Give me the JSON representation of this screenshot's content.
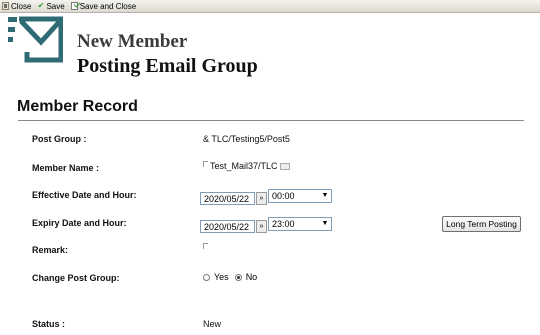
{
  "toolbar": {
    "close_label": "Close",
    "save_label": "Save",
    "save_close_label": "Save and Close"
  },
  "header": {
    "title_line1": "New Member",
    "title_line2": "Posting Email Group"
  },
  "section": {
    "title": "Member Record"
  },
  "form": {
    "post_group_label": "Post Group :",
    "post_group_value": "& TLC/Testing5/Post5",
    "member_name_label": "Member Name :",
    "member_name_value": "Test_Mail37/TLC",
    "effective_label": "Effective Date and Hour:",
    "effective_date": "2020/05/22",
    "effective_hour": "00:00",
    "expiry_label": "Expiry Date and Hour:",
    "expiry_date": "2020/05/22",
    "expiry_hour": "23:00",
    "long_term_button": "Long Term Posting",
    "remark_label": "Remark:",
    "remark_value": "",
    "change_group_label": "Change Post Group:",
    "option_yes": "Yes",
    "option_no": "No",
    "selected_option": "No",
    "status_label": "Status :",
    "status_value": "New"
  },
  "colors": {
    "logo_teal": "#2f6b74",
    "input_border": "#7f9db9"
  }
}
